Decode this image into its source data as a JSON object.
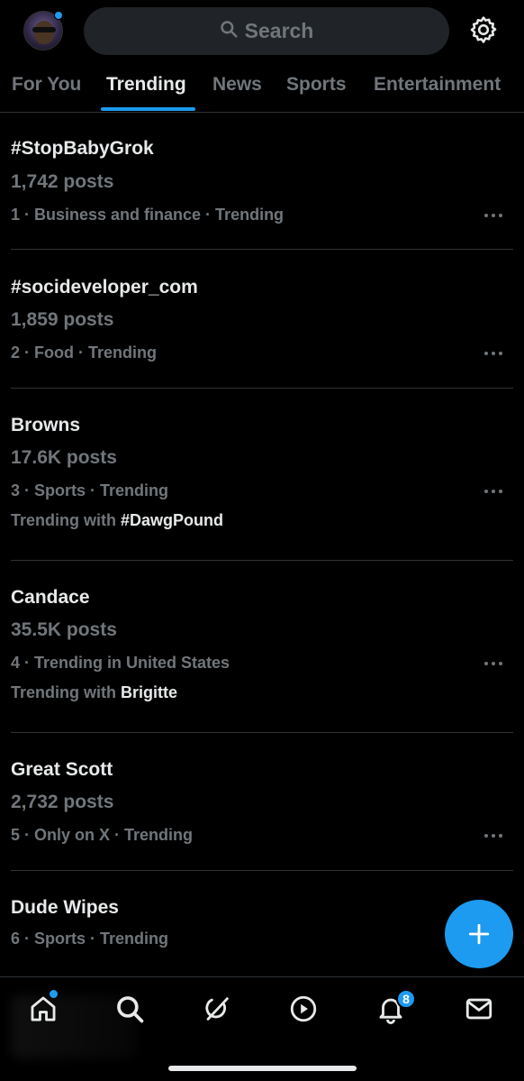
{
  "search": {
    "placeholder": "Search"
  },
  "tabs": [
    {
      "label": "For You",
      "active": false
    },
    {
      "label": "Trending",
      "active": true
    },
    {
      "label": "News",
      "active": false
    },
    {
      "label": "Sports",
      "active": false
    },
    {
      "label": "Entertainment",
      "active": false
    }
  ],
  "trends": [
    {
      "title": "#StopBabyGrok",
      "posts": "1,742 posts",
      "meta": "1 · Business and finance · Trending"
    },
    {
      "title": "#socideveloper_com",
      "posts": "1,859 posts",
      "meta": "2 · Food · Trending"
    },
    {
      "title": "Browns",
      "posts": "17.6K posts",
      "meta": "3 · Sports · Trending",
      "with_label": "Trending with",
      "with_value": "#DawgPound"
    },
    {
      "title": "Candace",
      "posts": "35.5K posts",
      "meta": "4 · Trending in United States",
      "with_label": "Trending with",
      "with_value": "Brigitte"
    },
    {
      "title": "Great Scott",
      "posts": "2,732 posts",
      "meta": "5 · Only on X · Trending"
    },
    {
      "title": "Dude Wipes",
      "meta": "6 · Sports · Trending"
    }
  ],
  "bottom_nav": {
    "items": [
      {
        "name": "home-icon",
        "has_dot": true
      },
      {
        "name": "search-icon"
      },
      {
        "name": "grok-icon"
      },
      {
        "name": "video-icon"
      },
      {
        "name": "notifications-icon",
        "badge": "8"
      },
      {
        "name": "messages-icon"
      }
    ]
  },
  "colors": {
    "accent": "#1d9bf0",
    "background": "#000000",
    "text": "#e7e9ea",
    "muted": "#71767b",
    "divider": "#2f3336"
  }
}
